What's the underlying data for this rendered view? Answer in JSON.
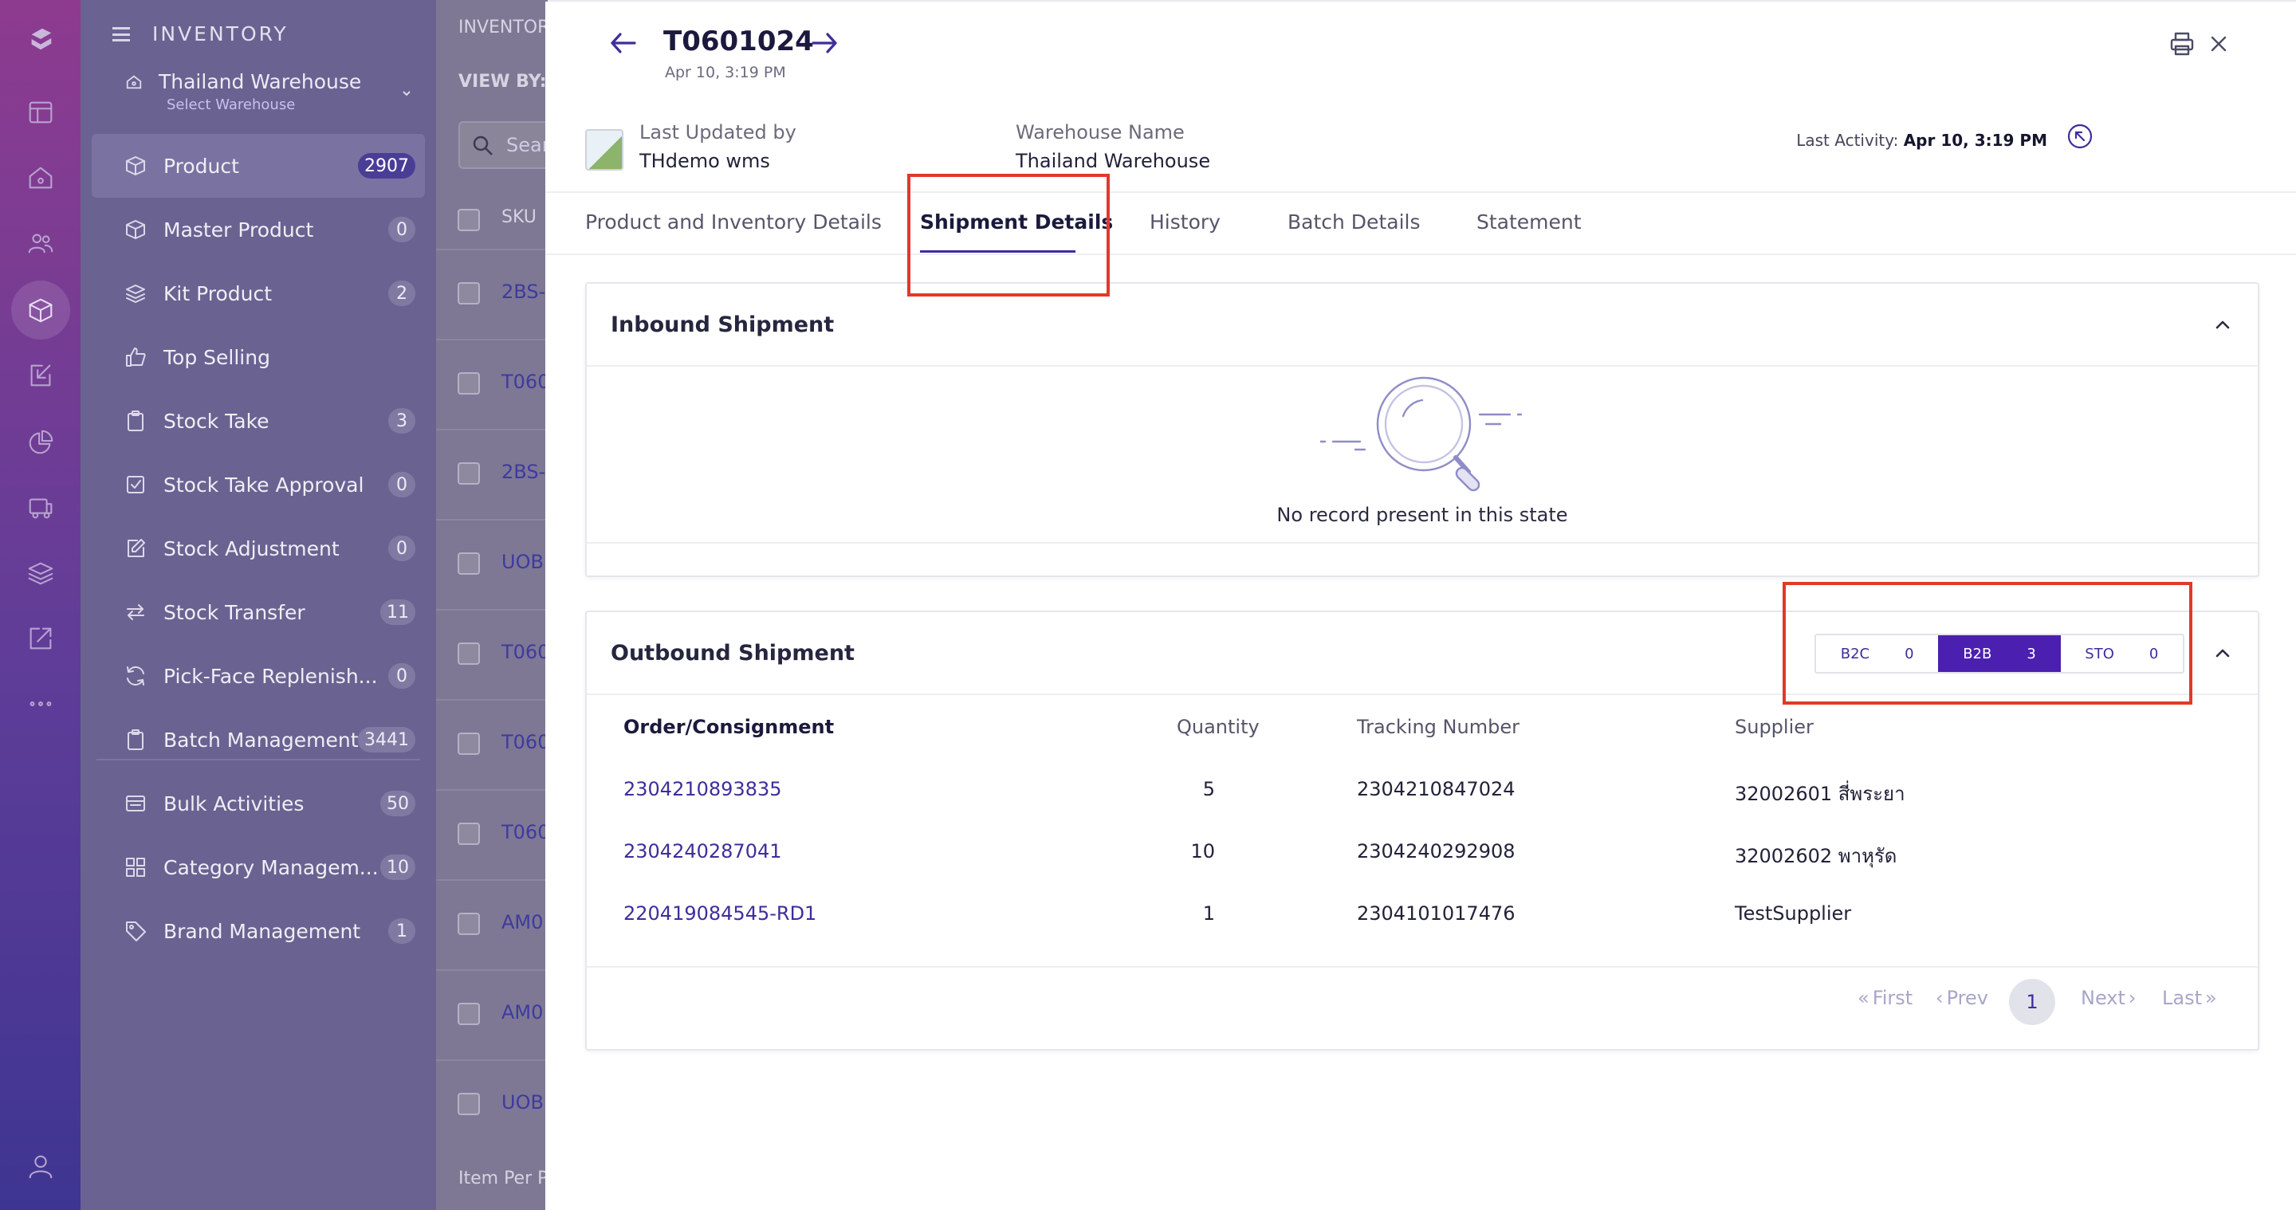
{
  "brand": {
    "rail_color_top": "#8d3b8f",
    "rail_color_bottom": "#3e3592",
    "accent": "#3d2e9c",
    "active_toggle": "#4b1fb0",
    "annotation": "#e03a2a"
  },
  "rail": {
    "icons": [
      "logo-icon",
      "dashboard-icon",
      "home-icon",
      "users-icon",
      "inventory-box-icon",
      "inbound-icon",
      "reports-icon",
      "truck-icon",
      "layers-icon",
      "outbound-icon",
      "more-icon",
      "profile-icon"
    ]
  },
  "menu": {
    "title": "INVENTORY",
    "warehouse": "Thailand Warehouse",
    "warehouse_sub": "Select Warehouse",
    "items": [
      {
        "label": "Product",
        "count": "2907",
        "icon": "box-icon",
        "active": true
      },
      {
        "label": "Master Product",
        "count": "0",
        "icon": "box-icon"
      },
      {
        "label": "Kit Product",
        "count": "2",
        "icon": "layers-icon"
      },
      {
        "label": "Top Selling",
        "count": "",
        "icon": "thumbs-up-icon"
      },
      {
        "label": "Stock Take",
        "count": "3",
        "icon": "clipboard-icon"
      },
      {
        "label": "Stock Take Approval",
        "count": "0",
        "icon": "check-square-icon"
      },
      {
        "label": "Stock Adjustment",
        "count": "0",
        "icon": "edit-icon"
      },
      {
        "label": "Stock Transfer",
        "count": "11",
        "icon": "transfer-icon"
      },
      {
        "label": "Pick-Face Replenish...",
        "count": "0",
        "icon": "refresh-icon"
      },
      {
        "label": "Batch Management",
        "count": "3441",
        "icon": "clipboard-icon"
      },
      {
        "label": "Bulk Activities",
        "count": "50",
        "icon": "bulk-icon"
      },
      {
        "label": "Category Managem...",
        "count": "10",
        "icon": "grid-icon"
      },
      {
        "label": "Brand Management",
        "count": "1",
        "icon": "tag-icon"
      }
    ]
  },
  "list": {
    "header": "INVENTOR",
    "view_by": "VIEW BY:",
    "search_placeholder": "Sear",
    "col_sku": "SKU",
    "rows": [
      "2BS-0",
      "T060",
      "2BS-0",
      "UOB",
      "T060",
      "T060",
      "T060",
      "AM0",
      "AM0",
      "UOB"
    ],
    "footer": "Item Per P"
  },
  "detail": {
    "title": "T0601024",
    "subtitle": "Apr 10, 3:19 PM",
    "last_updated_label": "Last Updated by",
    "last_updated_value": "THdemo wms",
    "warehouse_label": "Warehouse Name",
    "warehouse_value": "Thailand Warehouse",
    "last_activity_label": "Last Activity:",
    "last_activity_value": "Apr 10, 3:19 PM",
    "tabs": [
      {
        "label": "Product and Inventory Details"
      },
      {
        "label": "Shipment Details",
        "active": true
      },
      {
        "label": "History"
      },
      {
        "label": "Batch Details"
      },
      {
        "label": "Statement"
      }
    ],
    "inbound": {
      "title": "Inbound Shipment",
      "empty_text": "No record present in this state"
    },
    "outbound": {
      "title": "Outbound Shipment",
      "toggle": [
        {
          "label": "B2C",
          "count": "0"
        },
        {
          "label": "B2B",
          "count": "3",
          "active": true
        },
        {
          "label": "STO",
          "count": "0"
        }
      ],
      "columns": [
        "Order/Consignment",
        "Quantity",
        "Tracking Number",
        "Supplier"
      ],
      "rows": [
        {
          "order": "2304210893835",
          "qty": "5",
          "tracking": "2304210847024",
          "supplier": "32002601 สี่พระยา"
        },
        {
          "order": "2304240287041",
          "qty": "10",
          "tracking": "2304240292908",
          "supplier": "32002602 พาหุรัด"
        },
        {
          "order": "220419084545-RD1",
          "qty": "1",
          "tracking": "2304101017476",
          "supplier": "TestSupplier"
        }
      ],
      "pagination": {
        "first": "First",
        "prev": "Prev",
        "current": "1",
        "next": "Next",
        "last": "Last"
      }
    }
  }
}
